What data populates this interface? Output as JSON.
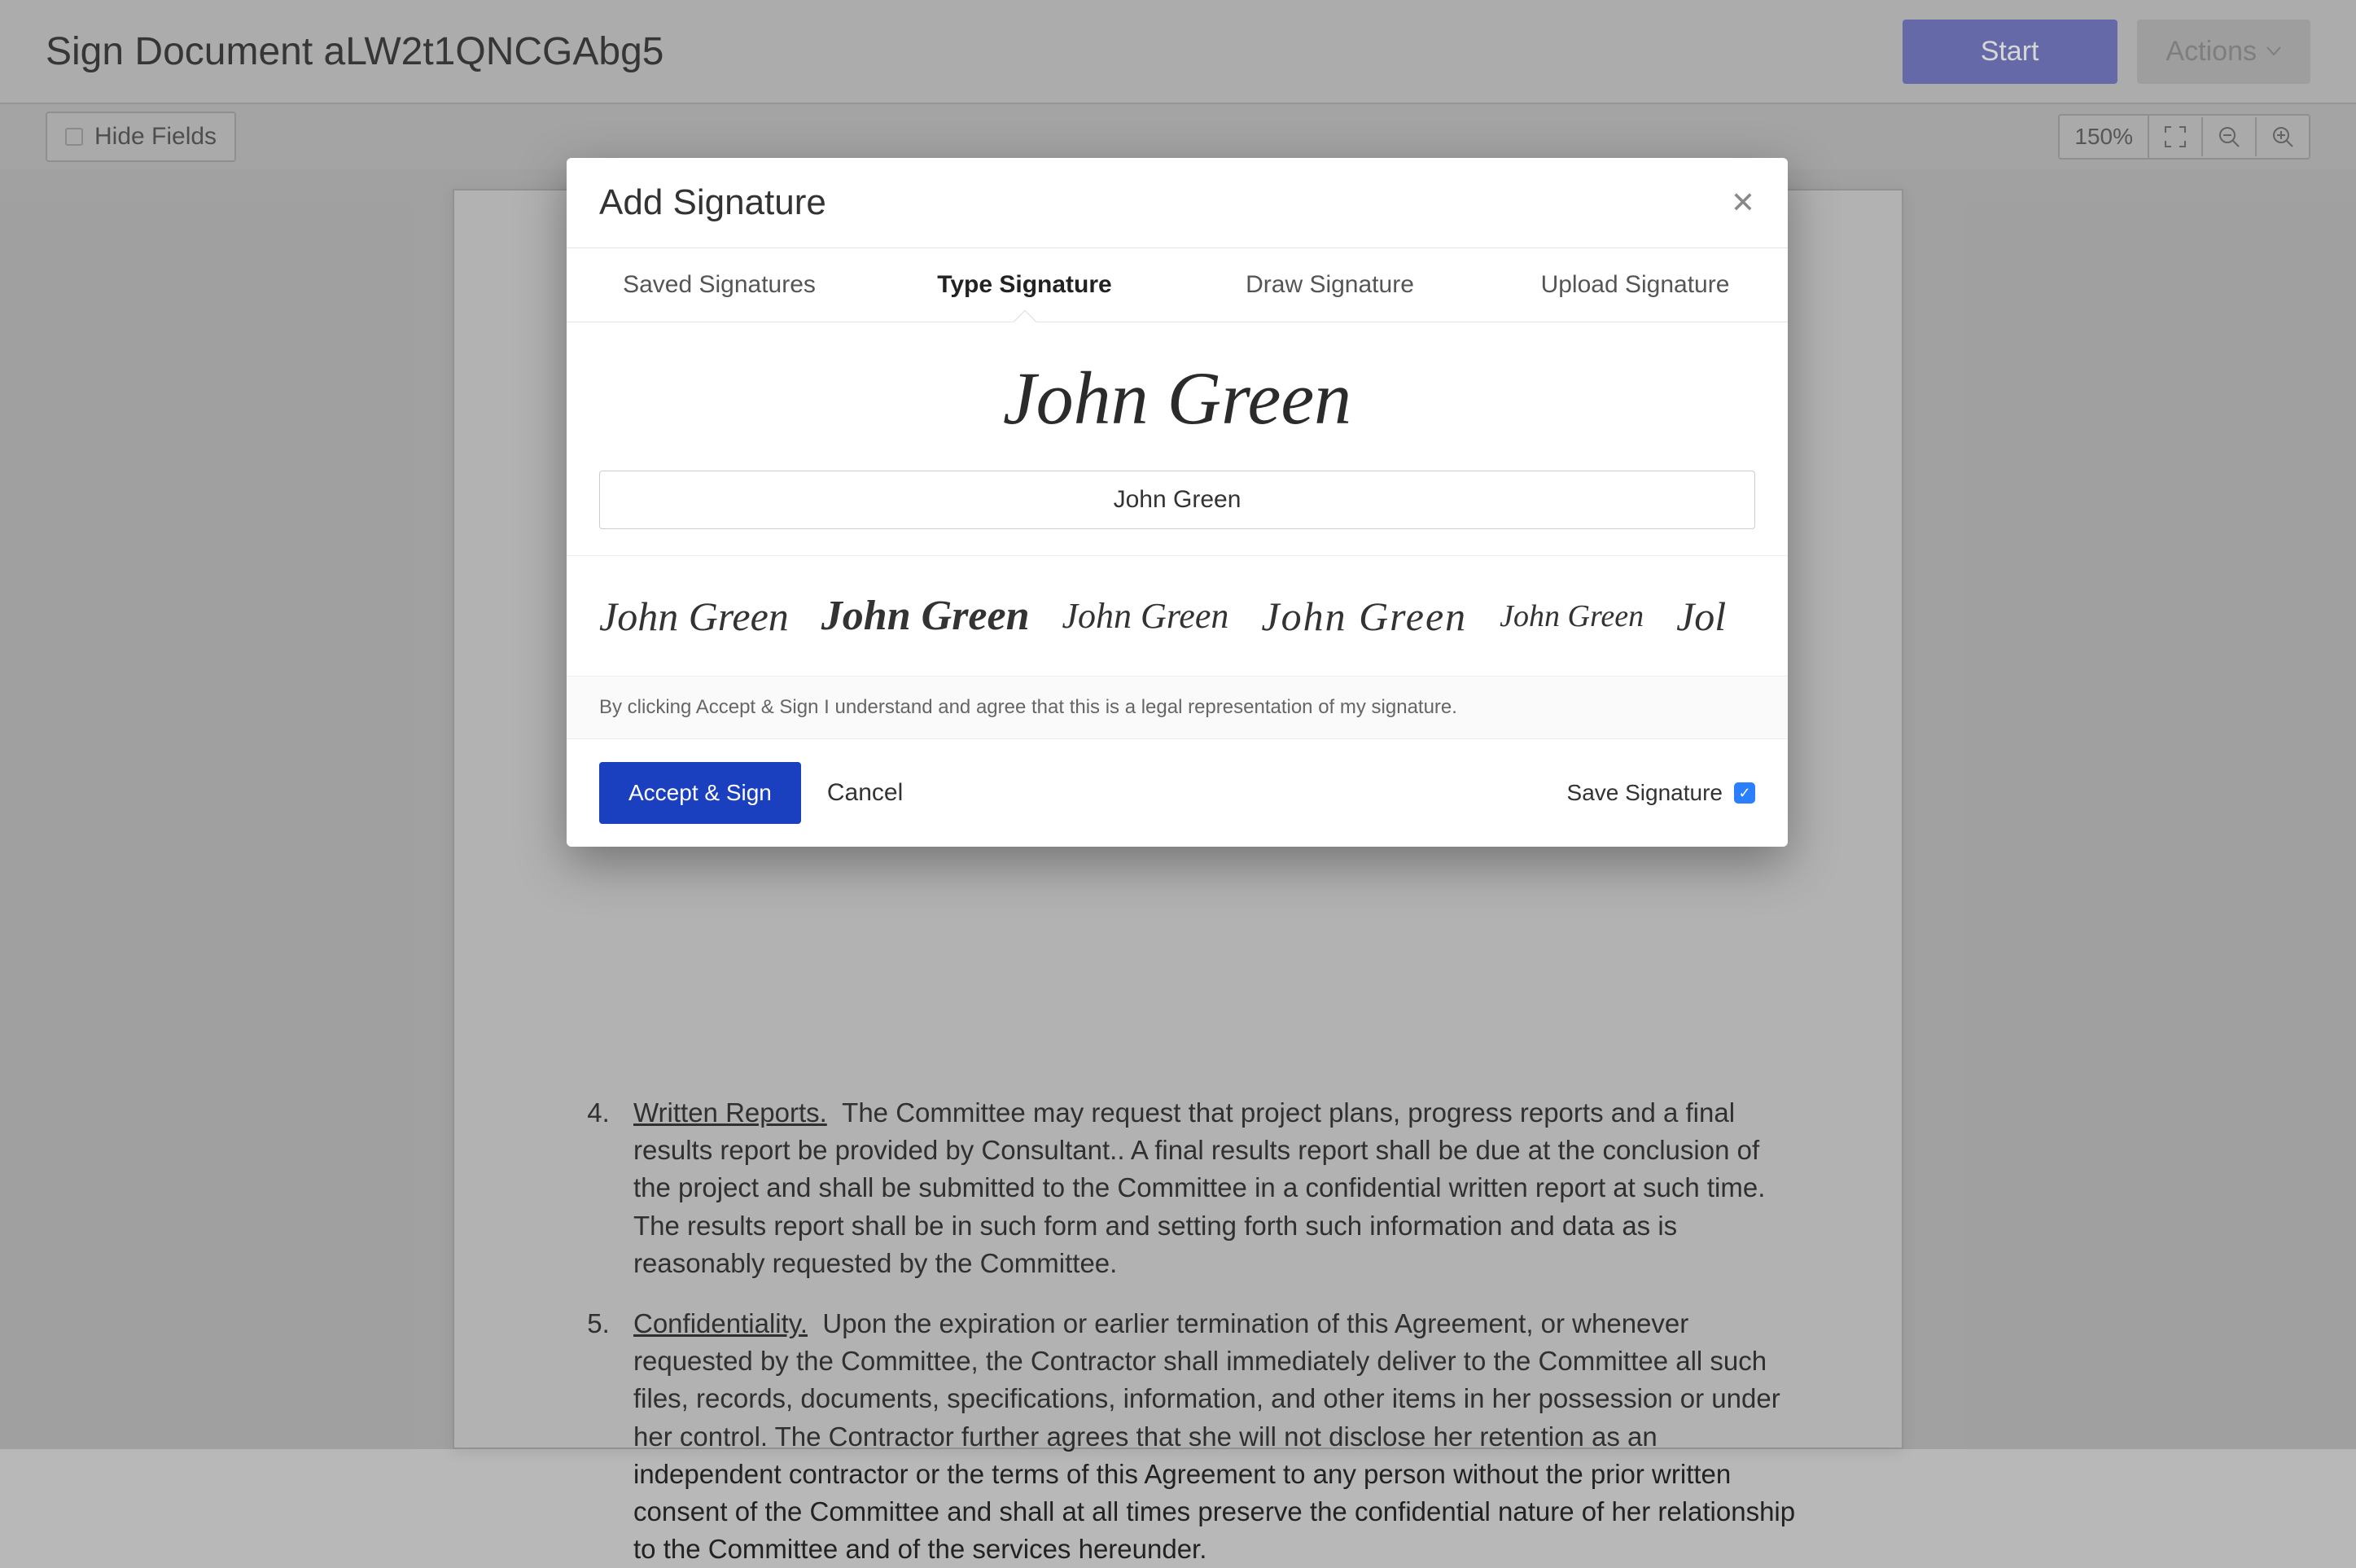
{
  "header": {
    "title": "Sign Document aLW2t1QNCGAbg5",
    "start_label": "Start",
    "actions_label": "Actions"
  },
  "toolbar": {
    "hide_fields_label": "Hide Fields",
    "zoom_level": "150%"
  },
  "document": {
    "item4_heading": "Written Reports.",
    "item4_body": "The Committee may request that project plans, progress reports and a final results report be provided by Consultant..  A final results report shall be due at the conclusion of the project and shall be submitted to the Committee in a confidential written report at such time. The results report shall be in such form and setting forth such information and data as is reasonably requested by the Committee.",
    "item5_heading": "Confidentiality.",
    "item5_body": "Upon the expiration or earlier termination of this Agreement, or whenever requested by the Committee, the Contractor shall immediately deliver to the Committee all such files, records, documents, specifications, information, and other items in her possession or under her control.  The Contractor further agrees that she will not disclose her retention as an independent contractor or the terms of this Agreement to any person without the prior written consent of the Committee and shall at all times preserve the confidential nature of her relationship to the Committee and of the services hereunder."
  },
  "modal": {
    "title": "Add Signature",
    "tabs": {
      "saved": "Saved Signatures",
      "type": "Type Signature",
      "draw": "Draw Signature",
      "upload": "Upload Signature"
    },
    "signature_preview": "John Green",
    "signature_input": "John Green",
    "font_options": [
      "John Green",
      "John Green",
      "John Green",
      "John Green",
      "John Green",
      "Jol"
    ],
    "legal_text": "By clicking Accept & Sign I understand and agree that this is a legal representation of my signature.",
    "accept_label": "Accept & Sign",
    "cancel_label": "Cancel",
    "save_label": "Save Signature",
    "save_checked": true
  }
}
